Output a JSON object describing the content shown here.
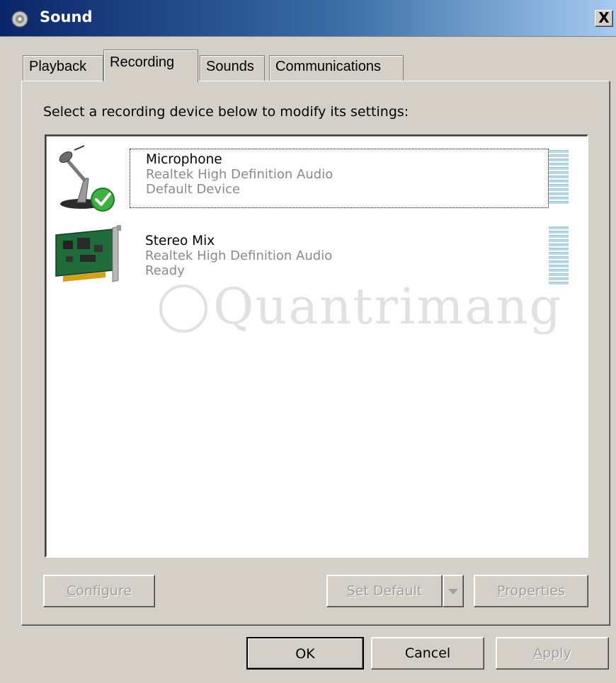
{
  "window": {
    "title": "Sound",
    "close_label": "X"
  },
  "tabs": [
    {
      "label": "Playback"
    },
    {
      "label": "Recording",
      "active": true
    },
    {
      "label": "Sounds"
    },
    {
      "label": "Communications"
    }
  ],
  "instruction": "Select a recording device below to modify its settings:",
  "devices": [
    {
      "name": "Microphone",
      "driver": "Realtek High Definition Audio",
      "status": "Default Device",
      "icon": "microphone-icon",
      "default": true,
      "selected": true
    },
    {
      "name": "Stereo Mix",
      "driver": "Realtek High Definition Audio",
      "status": "Ready",
      "icon": "sound-card-icon",
      "default": false,
      "selected": false
    }
  ],
  "watermark": "Quantrimang",
  "buttons": {
    "configure": {
      "prefix": "",
      "underline": "C",
      "rest": "onfigure",
      "enabled": false
    },
    "set_default": {
      "prefix": "",
      "underline": "S",
      "rest": "et Default",
      "enabled": false
    },
    "properties": {
      "prefix": "",
      "underline": "P",
      "rest": "roperties",
      "enabled": false
    },
    "ok": {
      "label": "OK"
    },
    "cancel": {
      "label": "Cancel"
    },
    "apply": {
      "prefix": "",
      "underline": "A",
      "rest": "pply",
      "enabled": false
    }
  },
  "colors": {
    "titlebar_start": "#0a246a",
    "titlebar_end": "#a6caf0",
    "dialog_bg": "#d4d0c8",
    "meter": "#b9d9e4",
    "check_green": "#3cb043"
  }
}
